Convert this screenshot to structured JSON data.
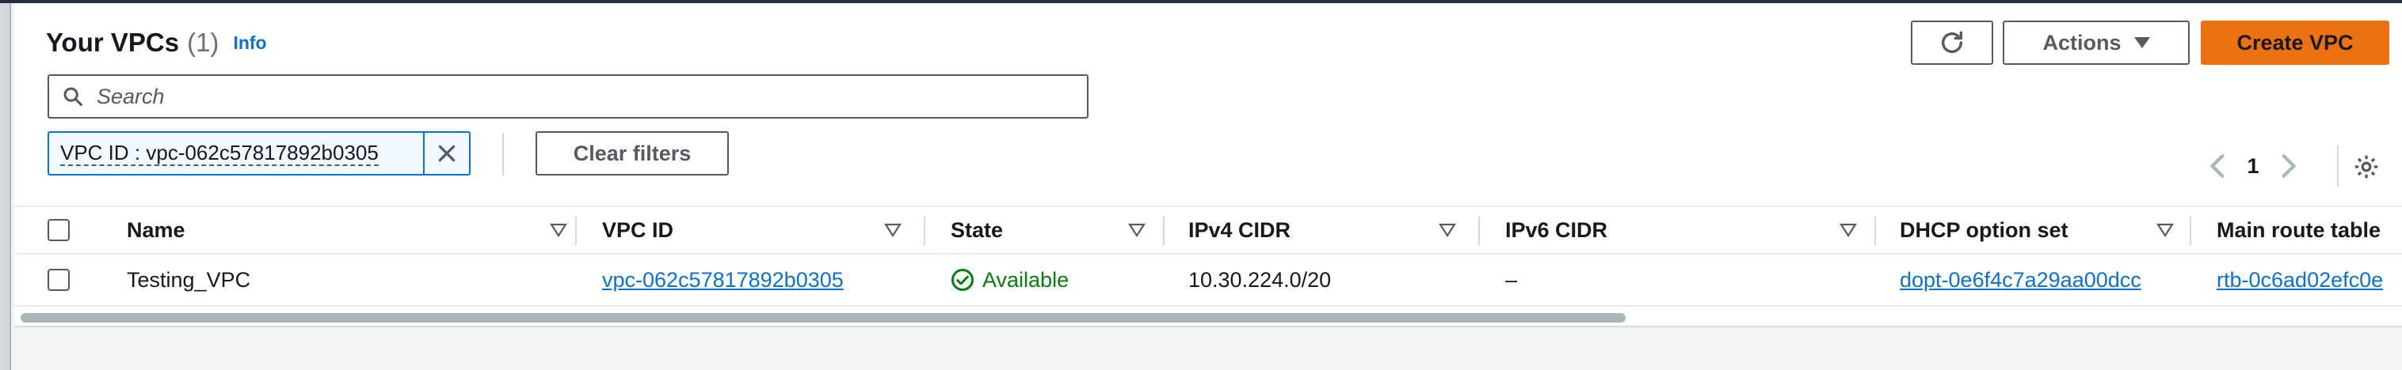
{
  "header": {
    "title": "Your VPCs",
    "count": "(1)",
    "info_link": "Info"
  },
  "toolbar": {
    "refresh_icon": "refresh-icon",
    "actions_label": "Actions",
    "create_label": "Create VPC"
  },
  "search": {
    "placeholder": "Search",
    "value": ""
  },
  "filters": {
    "token_label": "VPC ID : vpc-062c57817892b0305",
    "clear_label": "Clear filters"
  },
  "pagination": {
    "current_page": "1"
  },
  "table": {
    "columns": [
      "Name",
      "VPC ID",
      "State",
      "IPv4 CIDR",
      "IPv6 CIDR",
      "DHCP option set",
      "Main route table"
    ],
    "rows": [
      {
        "name": "Testing_VPC",
        "vpc_id": "vpc-062c57817892b0305",
        "state": "Available",
        "ipv4_cidr": "10.30.224.0/20",
        "ipv6_cidr": "–",
        "dhcp_option_set": "dopt-0e6f4c7a29aa00dcc",
        "main_route_table": "rtb-0c6ad02efc0e"
      }
    ]
  },
  "colors": {
    "primary_button": "#ec7211",
    "link": "#0972d3",
    "status_available": "#037f0c"
  }
}
